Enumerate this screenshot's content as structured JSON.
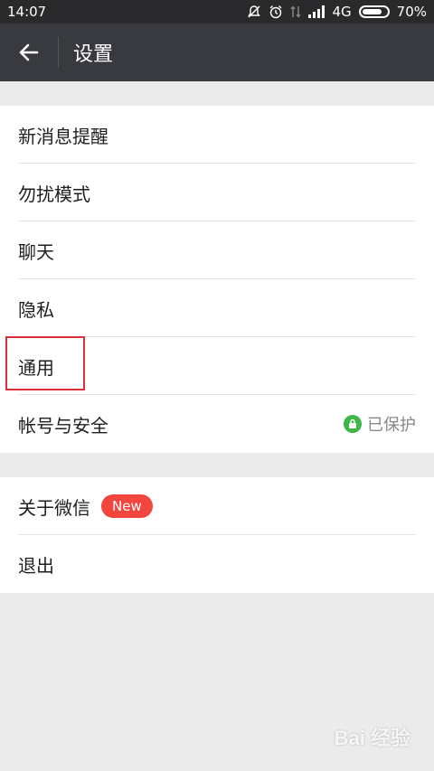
{
  "status_bar": {
    "time": "14:07",
    "network": "4G",
    "battery": "70%",
    "icons": [
      "bell-off-icon",
      "alarm-icon",
      "data-arrows-icon",
      "signal-icon",
      "battery-icon"
    ]
  },
  "toolbar": {
    "back_icon": "arrow-left-icon",
    "title": "设置"
  },
  "groups": {
    "main": [
      {
        "label": "新消息提醒"
      },
      {
        "label": "勿扰模式"
      },
      {
        "label": "聊天"
      },
      {
        "label": "隐私"
      },
      {
        "label": "通用"
      },
      {
        "label": "帐号与安全",
        "status": "已保护",
        "status_icon": "lock-icon"
      }
    ],
    "secondary": [
      {
        "label": "关于微信",
        "badge": "New"
      },
      {
        "label": "退出"
      }
    ]
  },
  "watermark": "Bai 经验",
  "colors": {
    "toolbar": "#393a3f",
    "status_bar": "#2a2a2c",
    "badge_red": "#f2453d",
    "lock_green": "#3fb64a",
    "highlight_border": "#d9303a"
  }
}
